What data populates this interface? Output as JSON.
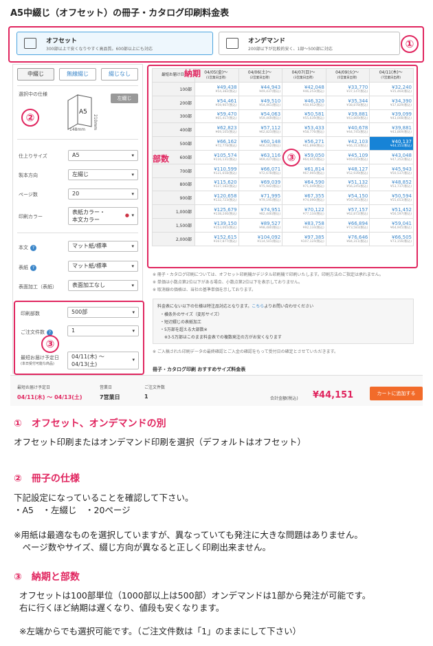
{
  "title": "A5中綴じ（オフセット）の冊子・カタログ印刷料金表",
  "methods": [
    {
      "name": "オフセット",
      "desc": "300部以上で安くなりやすく高品質。600部以上にも対応",
      "selected": true
    },
    {
      "name": "オンデマンド",
      "desc": "200部以下が比較的安く、1部〜500部に対応",
      "selected": false
    }
  ],
  "callouts": {
    "n1": "①",
    "n2": "②",
    "n3": "③"
  },
  "binding_tabs": [
    "中綴じ",
    "無線綴じ",
    "綴じなし"
  ],
  "spec": {
    "heading": "選択中の仕様",
    "left_bind": "左綴じ",
    "size_label": "A5",
    "height": "210mm",
    "width": "148mm"
  },
  "form": {
    "size": {
      "label": "仕上りサイズ",
      "value": "A5"
    },
    "direction": {
      "label": "製本方向",
      "value": "左綴じ"
    },
    "pages": {
      "label": "ページ数",
      "value": "20"
    },
    "color": {
      "label": "印刷カラー",
      "value1": "表紙カラー・",
      "value2": "本文カラー"
    },
    "body": {
      "label": "本文",
      "value": "マット紙/標準"
    },
    "cover": {
      "label": "表紙",
      "value": "マット紙/標準"
    },
    "finish": {
      "label": "表面加工（表紙）",
      "value": "表面加工なし"
    },
    "qty": {
      "label": "印刷部数",
      "value": "500部"
    },
    "orders": {
      "label": "ご注文件数",
      "value": "1"
    },
    "delivery": {
      "label1": "最短お届け予定日",
      "label2": "(本日受付可能な商品)",
      "value1": "04/11(木) ～",
      "value2": "04/13(土)"
    }
  },
  "table": {
    "corner": "最短お届け日",
    "cols": [
      {
        "date": "04/05(金)～",
        "sub": "(1営業日出荷)"
      },
      {
        "date": "04/06(土)～",
        "sub": "(2営業日出荷)"
      },
      {
        "date": "04/07(日)～",
        "sub": "(3営業日出荷)"
      },
      {
        "date": "04/09(火)～",
        "sub": "(5営業日出荷)"
      },
      {
        "date": "04/11(木)～",
        "sub": "(7営業日出荷)"
      }
    ],
    "rows": [
      {
        "qty": "100部",
        "cells": [
          [
            "¥49,438",
            "¥54,382(税込)"
          ],
          [
            "¥44,943",
            "¥49,437(税込)"
          ],
          [
            "¥42,048",
            "¥46,253(税込)"
          ],
          [
            "¥33,770",
            "¥37,147(税込)"
          ],
          [
            "¥32,240",
            "¥35,464(税込)"
          ]
        ]
      },
      {
        "qty": "200部",
        "cells": [
          [
            "¥54,461",
            "¥59,907(税込)"
          ],
          [
            "¥49,510",
            "¥54,461(税込)"
          ],
          [
            "¥46,320",
            "¥50,952(税込)"
          ],
          [
            "¥35,344",
            "¥38,878(税込)"
          ],
          [
            "¥34,390",
            "¥37,829(税込)"
          ]
        ]
      },
      {
        "qty": "300部",
        "cells": [
          [
            "¥59,470",
            "¥65,417(税込)"
          ],
          [
            "¥54,063",
            "¥59,469(税込)"
          ],
          [
            "¥50,581",
            "¥55,639(税込)"
          ],
          [
            "¥39,881",
            "¥43,869(税込)"
          ],
          [
            "¥39,099",
            "¥43,008(税込)"
          ]
        ]
      },
      {
        "qty": "400部",
        "cells": [
          [
            "¥62,823",
            "¥69,105(税込)"
          ],
          [
            "¥57,112",
            "¥62,823(税込)"
          ],
          [
            "¥53,433",
            "¥58,776(税込)"
          ],
          [
            "¥40,678",
            "¥44,745(税込)"
          ],
          [
            "¥39,881",
            "¥43,869(税込)"
          ]
        ]
      },
      {
        "qty": "500部",
        "cells": [
          [
            "¥66,162",
            "¥72,778(税込)"
          ],
          [
            "¥60,148",
            "¥66,162(税込)"
          ],
          [
            "¥56,271",
            "¥61,898(税込)"
          ],
          [
            "¥42,103",
            "¥46,313(税込)"
          ],
          [
            "¥40,137",
            "¥44,151(税込)"
          ]
        ]
      },
      {
        "qty": "600部",
        "cells": [
          [
            "¥105,574",
            "¥116,131(税込)"
          ],
          [
            "¥63,116",
            "¥69,427(税込)"
          ],
          [
            "¥59,050",
            "¥64,955(税込)"
          ],
          [
            "¥45,109",
            "¥49,619(税込)"
          ],
          [
            "¥43,048",
            "¥47,352(税込)"
          ]
        ]
      },
      {
        "qty": "700部",
        "cells": [
          [
            "¥110,599",
            "¥121,658(税込)"
          ],
          [
            "¥66,071",
            "¥72,678(税込)"
          ],
          [
            "¥61,814",
            "¥67,995(税込)"
          ],
          [
            "¥48,127",
            "¥52,939(税込)"
          ],
          [
            "¥45,943",
            "¥50,537(税込)"
          ]
        ]
      },
      {
        "qty": "800部",
        "cells": [
          [
            "¥115,620",
            "¥127,182(税込)"
          ],
          [
            "¥69,039",
            "¥75,942(税込)"
          ],
          [
            "¥64,590",
            "¥71,049(税込)"
          ],
          [
            "¥51,132",
            "¥56,245(税込)"
          ],
          [
            "¥48,852",
            "¥53,737(税込)"
          ]
        ]
      },
      {
        "qty": "900部",
        "cells": [
          [
            "¥120,658",
            "¥132,723(税込)"
          ],
          [
            "¥71,995",
            "¥79,195(税込)"
          ],
          [
            "¥67,355",
            "¥74,090(税込)"
          ],
          [
            "¥54,150",
            "¥59,565(税込)"
          ],
          [
            "¥50,594",
            "¥55,653(税込)"
          ]
        ]
      },
      {
        "qty": "1,000部",
        "cells": [
          [
            "¥125,679",
            "¥138,246(税込)"
          ],
          [
            "¥74,951",
            "¥82,446(税込)"
          ],
          [
            "¥70,122",
            "¥77,134(税込)"
          ],
          [
            "¥57,157",
            "¥62,872(税込)"
          ],
          [
            "¥51,452",
            "¥56,597(税込)"
          ]
        ]
      },
      {
        "qty": "1,500部",
        "cells": [
          [
            "¥139,150",
            "¥153,065(税込)"
          ],
          [
            "¥89,527",
            "¥98,480(税込)"
          ],
          [
            "¥83,758",
            "¥92,134(税込)"
          ],
          [
            "¥66,894",
            "¥73,583(税込)"
          ],
          [
            "¥59,041",
            "¥64,945(税込)"
          ]
        ]
      },
      {
        "qty": "2,000部",
        "cells": [
          [
            "¥152,615",
            "¥167,877(税込)"
          ],
          [
            "¥104,092",
            "¥114,501(税込)"
          ],
          [
            "¥97,385",
            "¥107,124(税込)"
          ],
          [
            "¥76,646",
            "¥84,311(税込)"
          ],
          [
            "¥66,505",
            "¥73,156(税込)"
          ]
        ]
      }
    ],
    "highlight": {
      "row": 4,
      "col": 4
    }
  },
  "red_labels": {
    "delivery": "納期",
    "qty": "部数"
  },
  "notes": [
    "※ 冊子・カタログ印刷については、オフセット印刷機かデジタル印刷機で印刷いたします。印刷方法のご指定は承れません。",
    "※ 単価は小数点第2位以下がある場合、小数点第2位以下を表示しておりません。",
    "※ 取消線の価格は、当社の基準単価を示しております。"
  ],
  "special": {
    "head": "料金表にない以下の仕様は特注品対応となります。",
    "link": "こちら",
    "tail": "よりお問い合わせください",
    "items": [
      "・横条外のサイズ（変形サイズ）",
      "・短辺綴じの表紙加工",
      "・5万部を超える大部数※",
      "※3-5万部はこのまま料金表での複数発注の方がお安くなります"
    ]
  },
  "data_note": "※ ご入稿された印刷データの最終確認とご入金の確認をもって受付日の確定とさせていただきます。",
  "recommend": "冊子・カタログ印刷 おすすめサイズ料金表",
  "summary": {
    "del_label": "最短お届け予定日",
    "del_value": "04/11(木) ～ 04/13(土)",
    "biz_label": "営業日",
    "biz_value": "7営業日",
    "ord_label": "ご注文件数",
    "ord_value": "1",
    "total_label": "合計金額(税込)",
    "total_value": "¥44,151",
    "cart": "カートに追加する"
  },
  "explain": [
    {
      "head": "①　オフセット、オンデマンドの別",
      "lines": [
        "オフセット印刷またはオンデマンド印刷を選択（デフォルトはオフセット）"
      ]
    },
    {
      "head": "②　冊子の仕様",
      "lines": [
        "下記設定になっていることを確認して下さい。",
        "・A5　・左綴じ　・20ページ",
        "",
        "※用紙は最適なものを選択していますが、異なっていても発注に大きな問題はありません。",
        "　ページ数やサイズ、綴じ方向が異なると正しく印刷出来ません。"
      ]
    },
    {
      "head": "③　納期と部数",
      "lines": [
        "オフセットは100部単位（1000部以上は500部）オンデマンドは1部から発注が可能です。",
        "右に行くほど納期は遅くなり、値段も安くなります。",
        "",
        "※左端からでも選択可能です。（ご注文件数は「1」のままにして下さい）"
      ]
    }
  ]
}
